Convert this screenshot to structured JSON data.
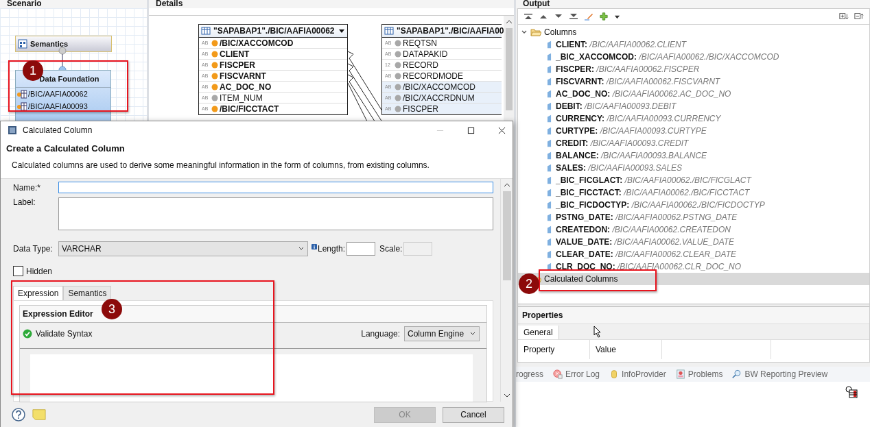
{
  "scenario": {
    "title": "Scenario",
    "semantics_node": {
      "label": "Semantics"
    },
    "foundation_node": {
      "label": "Data Foundation",
      "tables": [
        "/BIC/AAFIA00062",
        "/BIC/AAFIA00093"
      ]
    },
    "callout": "1"
  },
  "details": {
    "title": "Details",
    "tables": [
      {
        "title": "\"SAPABAP1\"./BIC/AAFIA00062",
        "has_menu": true,
        "columns": [
          {
            "type": "AB",
            "name": "/BIC/XACCOMCOD",
            "key": true,
            "highlighted": false
          },
          {
            "type": "AB",
            "name": "CLIENT",
            "key": true,
            "highlighted": false
          },
          {
            "type": "AB",
            "name": "FISCPER",
            "key": true,
            "highlighted": false
          },
          {
            "type": "AB",
            "name": "FISCVARNT",
            "key": true,
            "highlighted": false
          },
          {
            "type": "AB",
            "name": "AC_DOC_NO",
            "key": true,
            "highlighted": false
          },
          {
            "type": "AB",
            "name": "ITEM_NUM",
            "key": false,
            "highlighted": false
          },
          {
            "type": "AB",
            "name": "/BIC/FICCTACT",
            "key": true,
            "highlighted": false
          }
        ]
      },
      {
        "title": "\"SAPABAP1\"./BIC/AAFIA00",
        "has_menu": false,
        "columns": [
          {
            "type": "AB",
            "name": "REQTSN",
            "key": false,
            "highlighted": false
          },
          {
            "type": "AB",
            "name": "DATAPAKID",
            "key": false,
            "highlighted": false
          },
          {
            "type": "12",
            "name": "RECORD",
            "key": false,
            "highlighted": false
          },
          {
            "type": "AB",
            "name": "RECORDMODE",
            "key": false,
            "highlighted": false
          },
          {
            "type": "AB",
            "name": "/BIC/XACCOMCOD",
            "key": false,
            "highlighted": true
          },
          {
            "type": "AB",
            "name": "/BIC/XACCRDNUM",
            "key": false,
            "highlighted": true
          },
          {
            "type": "AB",
            "name": "FISCPER",
            "key": false,
            "highlighted": true
          }
        ]
      }
    ]
  },
  "output": {
    "title": "Output",
    "tree": [
      {
        "label": "Columns",
        "expanded": true,
        "selected": false,
        "children": [
          {
            "name": "CLIENT:",
            "source": "/BIC/AAFIA00062.CLIENT"
          },
          {
            "name": "_BIC_XACCOMCOD:",
            "source": "/BIC/AAFIA00062./BIC/XACCOMCOD"
          },
          {
            "name": "FISCPER:",
            "source": "/BIC/AAFIA00062.FISCPER"
          },
          {
            "name": "FISCVARNT:",
            "source": "/BIC/AAFIA00062.FISCVARNT"
          },
          {
            "name": "AC_DOC_NO:",
            "source": "/BIC/AAFIA00062.AC_DOC_NO"
          },
          {
            "name": "DEBIT:",
            "source": "/BIC/AAFIA00093.DEBIT"
          },
          {
            "name": "CURRENCY:",
            "source": "/BIC/AAFIA00093.CURRENCY"
          },
          {
            "name": "CURTYPE:",
            "source": "/BIC/AAFIA00093.CURTYPE"
          },
          {
            "name": "CREDIT:",
            "source": "/BIC/AAFIA00093.CREDIT"
          },
          {
            "name": "BALANCE:",
            "source": "/BIC/AAFIA00093.BALANCE"
          },
          {
            "name": "SALES:",
            "source": "/BIC/AAFIA00093.SALES"
          },
          {
            "name": "_BIC_FICGLACT:",
            "source": "/BIC/AAFIA00062./BIC/FICGLACT"
          },
          {
            "name": "_BIC_FICCTACT:",
            "source": "/BIC/AAFIA00062./BIC/FICCTACT"
          },
          {
            "name": "_BIC_FICDOCTYP:",
            "source": "/BIC/AAFIA00062./BIC/FICDOCTYP"
          },
          {
            "name": "PSTNG_DATE:",
            "source": "/BIC/AAFIA00062.PSTNG_DATE"
          },
          {
            "name": "CREATEDON:",
            "source": "/BIC/AAFIA00062.CREATEDON"
          },
          {
            "name": "VALUE_DATE:",
            "source": "/BIC/AAFIA00062.VALUE_DATE"
          },
          {
            "name": "CLEAR_DATE:",
            "source": "/BIC/AAFIA00062.CLEAR_DATE"
          },
          {
            "name": "CLR_DOC_NO:",
            "source": "/BIC/AAFIA00062.CLR_DOC_NO"
          }
        ]
      },
      {
        "label": "Calculated Columns",
        "expanded": false,
        "selected": true
      }
    ],
    "callout": "2"
  },
  "properties": {
    "title": "Properties",
    "tabs": [
      {
        "label": "General",
        "selected": true
      }
    ],
    "columns": [
      "Property",
      "Value"
    ]
  },
  "bottom_tabs": [
    {
      "label": "rogress",
      "kind": "plain"
    },
    {
      "label": "Error Log",
      "kind": "log"
    },
    {
      "label": "InfoProvider",
      "kind": "provider"
    },
    {
      "label": "Problems",
      "kind": "problems"
    },
    {
      "label": "BW Reporting Preview",
      "kind": "preview"
    }
  ],
  "dialog": {
    "title": "Calculated Column",
    "heading": "Create a Calculated Column",
    "description": "Calculated columns are used to derive some meaningful information in the form of columns, from existing columns.",
    "name_label": "Name:*",
    "label_label": "Label:",
    "data_type_label": "Data Type:",
    "data_type": "VARCHAR",
    "length_label": "Length:",
    "scale_label": "Scale:",
    "scale_disabled": true,
    "hidden": {
      "label": "Hidden",
      "checked": false
    },
    "tabs": [
      {
        "label": "Expression",
        "selected": true
      },
      {
        "label": "Semantics",
        "selected": false
      }
    ],
    "editor": {
      "title": "Expression Editor",
      "validate": "Validate Syntax",
      "language_label": "Language:",
      "language": "Column Engine"
    },
    "callout": "3",
    "buttons": [
      {
        "label": "OK",
        "disabled": true
      },
      {
        "label": "Cancel",
        "disabled": false
      }
    ]
  }
}
